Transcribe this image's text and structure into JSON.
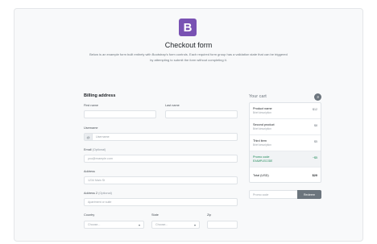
{
  "header": {
    "logo_letter": "B",
    "title": "Checkout form",
    "lead": "Below is an example form built entirely with Bootstrap's form controls. Each required form group has a validation state that can be triggered by attempting to submit the form without completing it."
  },
  "billing": {
    "heading": "Billing address",
    "first_name_label": "First name",
    "last_name_label": "Last name",
    "username_label": "Username",
    "username_addon": "@",
    "username_placeholder": "Username",
    "email_label": "Email",
    "email_optional": "(Optional)",
    "email_placeholder": "you@example.com",
    "address_label": "Address",
    "address_placeholder": "1234 Main St",
    "address2_label": "Address 2",
    "address2_optional": "(Optional)",
    "address2_placeholder": "Apartment or suite",
    "country_label": "Country",
    "country_value": "Choose...",
    "state_label": "State",
    "state_value": "Choose...",
    "zip_label": "Zip"
  },
  "cart": {
    "heading": "Your cart",
    "count": "3",
    "items": [
      {
        "name": "Product name",
        "desc": "Brief description",
        "price": "$12"
      },
      {
        "name": "Second product",
        "desc": "Brief description",
        "price": "$8"
      },
      {
        "name": "Third item",
        "desc": "Brief description",
        "price": "$5"
      },
      {
        "name": "Promo code",
        "desc": "EXAMPLECODE",
        "price": "−$5"
      }
    ],
    "total_label": "Total (USD)",
    "total_value": "$20",
    "promo_placeholder": "Promo code",
    "redeem_label": "Redeem"
  },
  "colors": {
    "brand": "#7952b3",
    "promo": "#198754",
    "button": "#6c757d"
  }
}
